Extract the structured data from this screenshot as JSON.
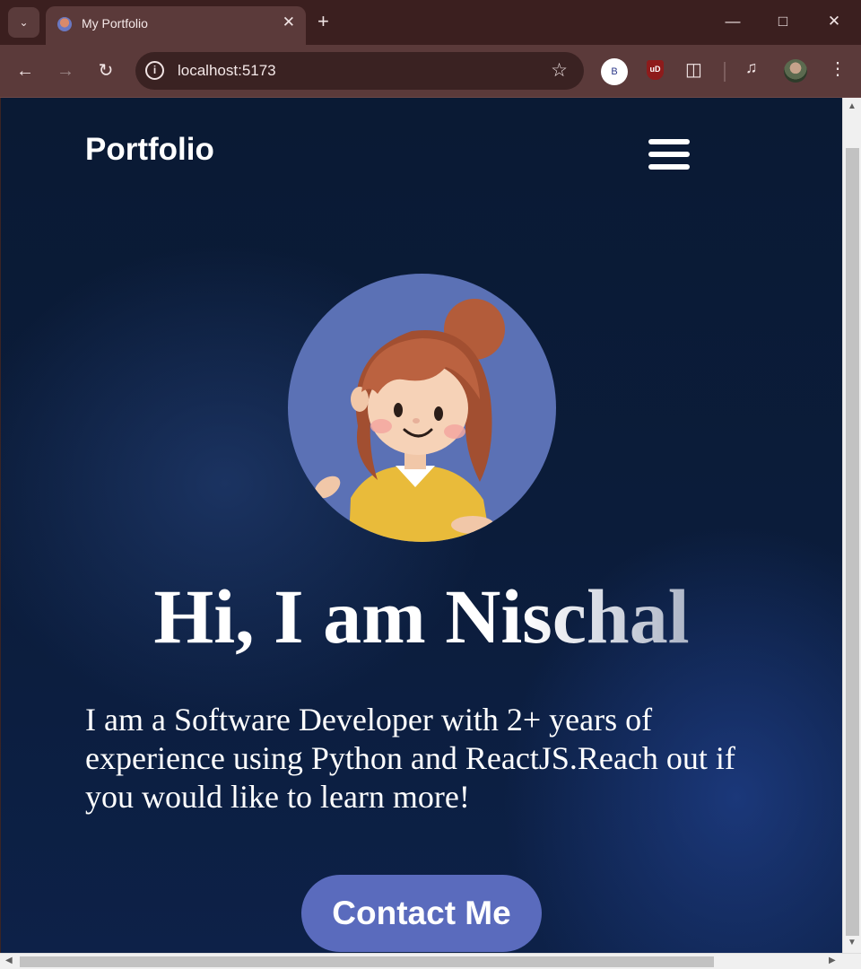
{
  "browser": {
    "tab_title": "My Portfolio",
    "tab_menu_icon": "chevron-down-icon",
    "tab_close_icon": "close-icon",
    "new_tab_icon": "plus-icon",
    "url": "localhost:5173",
    "extension_b_label": "B",
    "extension_ublock_label": "uD",
    "colors": {
      "titlebar": "#3b1f1f",
      "toolbar": "#5b3a3a",
      "omnibox": "#3a2222"
    }
  },
  "site": {
    "logo": "Portfolio",
    "menu_icon": "hamburger-menu-icon",
    "hero": {
      "heading": "Hi, I am Nischal",
      "description": "I am a Software Developer with 2+ years of experience using Python and ReactJS.Reach out if you would like to learn more!",
      "cta_label": "Contact Me"
    },
    "colors": {
      "background": "#0b1c3a",
      "accent": "#5a6bbd",
      "avatar_bg": "#5b71b5",
      "text": "#ffffff"
    }
  }
}
